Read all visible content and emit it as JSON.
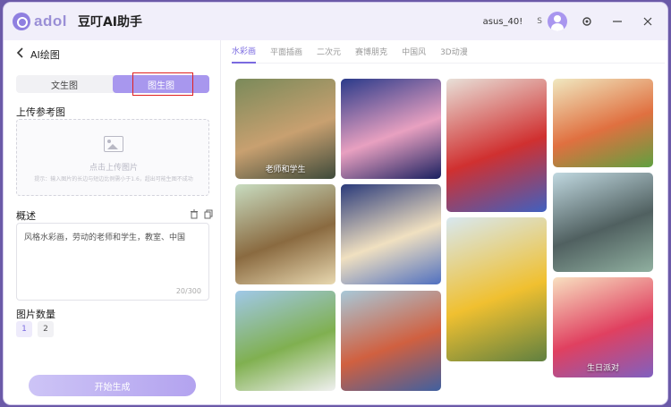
{
  "titlebar": {
    "logo_text": "adol",
    "app_title": "豆叮AI助手",
    "username": "asus_40!",
    "badge": "S",
    "icons": [
      "avatar",
      "gear-icon",
      "minimize-icon",
      "close-icon"
    ]
  },
  "left": {
    "back_label": "AI绘图",
    "modes": [
      {
        "label": "文生图",
        "active": false
      },
      {
        "label": "图生图",
        "active": true
      }
    ],
    "upload_label": "上传参考图",
    "upload_text": "点击上传图片",
    "upload_tip": "提示：输入图片的长边与短边比例需小于1.6，超出可能生图不成功",
    "desc_label": "概述",
    "desc_text": "风格水彩画，劳动的老师和学生，教室、中国",
    "char_count": "20/300",
    "count_label": "图片数量",
    "count_options": [
      "1",
      "2"
    ],
    "generate_label": "开始生成"
  },
  "right": {
    "tabs": [
      {
        "label": "水彩画",
        "active": true
      },
      {
        "label": "平面插画",
        "active": false
      },
      {
        "label": "二次元",
        "active": false
      },
      {
        "label": "赛博朋克",
        "active": false
      },
      {
        "label": "中国风",
        "active": false
      },
      {
        "label": "3D动漫",
        "active": false
      }
    ],
    "tiles": [
      {
        "caption": "老师和学生",
        "colors": [
          "#7a8a5a",
          "#c8a070",
          "#3e4a3a"
        ]
      },
      {
        "caption": "",
        "colors": [
          "#2a3a8a",
          "#e8a0c0",
          "#1a2060"
        ]
      },
      {
        "caption": "",
        "colors": [
          "#e8e0d8",
          "#d03030",
          "#4060c0"
        ]
      },
      {
        "caption": "",
        "colors": [
          "#f0e8c0",
          "#e07040",
          "#60a040"
        ]
      },
      {
        "caption": "",
        "colors": [
          "#c8dcc0",
          "#8a6a40",
          "#e8d8b0"
        ]
      },
      {
        "caption": "",
        "colors": [
          "#2a3a7a",
          "#f0e0c0",
          "#5070c0"
        ]
      },
      {
        "caption": "",
        "colors": [
          "#d8e8f0",
          "#f0c030",
          "#608040"
        ]
      },
      {
        "caption": "",
        "colors": [
          "#c0d8e0",
          "#506060",
          "#90b0a0"
        ]
      },
      {
        "caption": "",
        "colors": [
          "#a0c8e8",
          "#80b050",
          "#f0f0f0"
        ]
      },
      {
        "caption": "",
        "colors": [
          "#a8c8d8",
          "#d06040",
          "#4060a0"
        ]
      },
      {
        "caption": "生日派对",
        "colors": [
          "#f8e0c0",
          "#e04060",
          "#8060c0"
        ]
      }
    ]
  },
  "colors": {
    "accent": "#a897ee",
    "accent_text": "#7a6ae0",
    "highlight_box": "#e02020"
  }
}
